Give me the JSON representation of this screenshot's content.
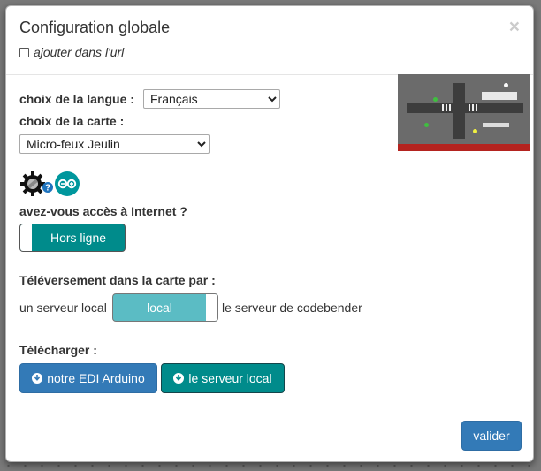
{
  "modal": {
    "title": "Configuration globale",
    "close_symbol": "×",
    "add_to_url_label": "ajouter dans l'url",
    "add_to_url_checked": false
  },
  "language": {
    "label": "choix de la langue :",
    "selected": "Français"
  },
  "board": {
    "label": "choix de la carte :",
    "selected": "Micro-feux Jeulin",
    "image_icon": "micro-feux-board-photo"
  },
  "icons": [
    "gear-icon",
    "help-icon",
    "arduino-icon"
  ],
  "internet": {
    "label": "avez-vous accès à Internet ?",
    "toggle_text": "Hors ligne"
  },
  "upload": {
    "label": "Téléversement dans la carte par :",
    "left_text": "un serveur local",
    "toggle_text": "local",
    "right_text": "le serveur de codebender"
  },
  "download": {
    "label": "Télécharger :",
    "button_arduino": "notre EDI Arduino",
    "button_server": "le serveur local"
  },
  "footer": {
    "validate_label": "valider"
  },
  "colors": {
    "primary": "#337ab7",
    "teal": "#008b8b",
    "teal_light": "#5bbcc4"
  }
}
